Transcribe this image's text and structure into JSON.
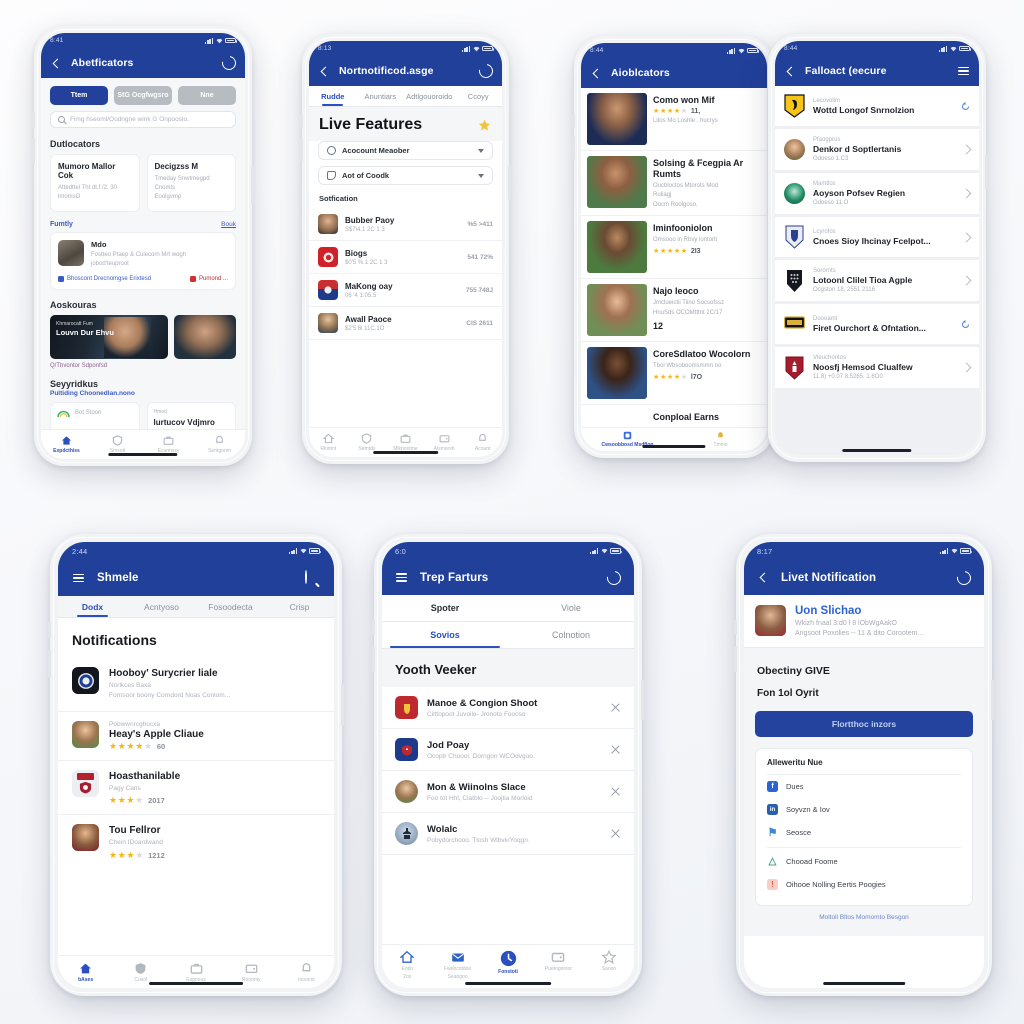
{
  "meta": {
    "accent_blue": "#21409a",
    "tab_blue": "#2b4fbf",
    "star_gold": "#f5b616",
    "bg": "#f7f8fb"
  },
  "phone1": {
    "status": {
      "time": "8:41",
      "signal": "signal-icon",
      "wifi": "wifi-icon",
      "battery": "battery-icon"
    },
    "appbar": {
      "back": "back-icon",
      "title": "Abetficators",
      "action": "refresh-icon"
    },
    "chips": [
      {
        "label": "Ttem",
        "active": true
      },
      {
        "label": "StG Ocgfwgsro",
        "active": false
      },
      {
        "label": "Nne",
        "active": false
      }
    ],
    "search": {
      "placeholder": "Fimg hseoml/Oodngne wink G Onpooslo.",
      "icon": "search-icon"
    },
    "section1": {
      "title": "Dutlocators"
    },
    "cards": [
      {
        "title": "Mumoro Mallor Cok",
        "sub": "Attedttel Tht dt.f /2. 30\nlmomsO"
      },
      {
        "title": "Decigzss M",
        "sub": "Tmeday Snwtmegpd Cnomts\nEoolgvmp"
      }
    ],
    "rowhead": {
      "left": "Fumtly",
      "right": "Bouk"
    },
    "wide": {
      "title": "Mdo",
      "sub": "Fostteo Ptaep & Culecorn Mrt wogh\njobod'teuproot",
      "foot_left": "Bhoscont Drecnomgse Erixtesd",
      "foot_right": "Pumond ..."
    },
    "section2": {
      "title": "Aoskouras"
    },
    "media": {
      "overline": "Khmarocatt Fum",
      "headline": "Louvn Dur Ehvu",
      "caption": "Q/Thvontor Sdponfsd"
    },
    "section3": {
      "title": "Seyyridkus",
      "sub": "Pultiding Choonedlan.nono"
    },
    "bottomcards": [
      {
        "title": "Bot Stoon"
      },
      {
        "title": "Hmod",
        "sub": "lurtucov Vdjmro"
      }
    ],
    "nav": [
      {
        "label": "Expdcthiss",
        "icon": "home-icon",
        "active": true
      },
      {
        "label": "Smsott",
        "icon": "shield-icon",
        "active": false
      },
      {
        "label": "Ecunnssy",
        "icon": "briefcase-icon",
        "active": false
      },
      {
        "label": "Sentgonm",
        "icon": "bell-icon",
        "active": false
      }
    ]
  },
  "phone2": {
    "status": {
      "time": "8:13"
    },
    "appbar": {
      "back": "back-icon",
      "title": "Nortnotificod.asge",
      "action": "refresh-icon"
    },
    "tabs": [
      {
        "label": "Rudde",
        "active": true
      },
      {
        "label": "Anuntiars",
        "active": false
      },
      {
        "label": "Adtlgouoroido",
        "active": false
      },
      {
        "label": "Ccoyy",
        "active": false
      }
    ],
    "hero": {
      "title": "Live Features",
      "badge": "star-badge-icon"
    },
    "dropdowns": [
      {
        "label": "Acocount Meaober",
        "icon": "refresh-circle-icon",
        "caret": "chevron-down-icon"
      },
      {
        "label": "Aot of Coodk",
        "icon": "shield-icon",
        "caret": "chevron-down-icon"
      }
    ],
    "listtitle": "Sotfication",
    "rows": [
      {
        "name": "Bubber Paoy",
        "sub": "S$7i4.1 2C 1 3",
        "value": "%5 >411"
      },
      {
        "name": "Biogs",
        "sub": "$0'5 %.1 2C 1 3",
        "value": "541 72%"
      },
      {
        "name": "MaKong oay",
        "sub": "06 '4 1:05.5",
        "value": "755 748J"
      },
      {
        "name": "Awall Paoce",
        "sub": "$2'5 6l 11C.1O",
        "value": "CIS 2611"
      }
    ],
    "nav": [
      {
        "label": "Rlomnt",
        "icon": "home-icon"
      },
      {
        "label": "Semtds",
        "icon": "shield-icon"
      },
      {
        "label": "Mlknontme",
        "icon": "briefcase-icon"
      },
      {
        "label": "Alsmorsh",
        "icon": "wallet-icon"
      },
      {
        "label": "Acount",
        "icon": "bell-icon"
      }
    ]
  },
  "phone3": {
    "status": {
      "time": "8:44"
    },
    "appbar": {
      "back": "back-icon",
      "title": "Aioblcators"
    },
    "apps": [
      {
        "title": "Como won Mif",
        "desc": "Litos Mo Loshle . hucrys",
        "stars": 4,
        "rating": "11,"
      },
      {
        "title": "Solsing & Fcegpia Ar Rumts",
        "desc": "Oucbloctos Mtorots Mod\nRuliagj\nOocm Roolgoso.",
        "stars": 0,
        "rating": ""
      },
      {
        "title": "Iminfooniolon",
        "desc": "Omsooo in Rbvy lontorti",
        "stars": 5,
        "rating": "2I3"
      },
      {
        "title": "Najo Ieoco",
        "desc": "Jmclueictii Tiino Socsofssz\nHnuSds OCOMtttnt 2C/17",
        "stars": 0,
        "rating": "12"
      },
      {
        "title": "CoreSdlatoo Wocolorn",
        "desc": "Tbol Wbsoboomsmmn no",
        "stars": 4,
        "rating": "l7O"
      },
      {
        "title": "Conploal Earns",
        "desc": "",
        "stars": 0,
        "rating": ""
      }
    ],
    "nav": [
      {
        "label": "Cwsoobbosd Msdflon",
        "icon": "grid-icon",
        "active": true
      },
      {
        "label": "Tmmo",
        "icon": "bell-icon",
        "active": false
      }
    ]
  },
  "phone4": {
    "status": {
      "time": "8:44"
    },
    "appbar": {
      "back": "back-icon",
      "title": "Falloact (eecure",
      "menu": "hamburger-icon"
    },
    "teams": [
      {
        "label": "Lecovolim",
        "name": "Wottd Longof Snrnolzion",
        "sub": "",
        "crest": "crest-yellow-icon",
        "trail": "sync-icon"
      },
      {
        "label": "Pfaogpros",
        "name": "Denkor d Soptlertanis",
        "sub": "Gdoeso 1.C3",
        "crest": "avatar-crest-icon",
        "trail": "chevron-right-icon"
      },
      {
        "label": "Mamtlos",
        "name": "Aoyson Pofsev Regien",
        "sub": "Gdoeso 11.O",
        "crest": "crest-green-icon",
        "trail": "chevron-right-icon"
      },
      {
        "label": "Lcyrofos",
        "name": "Cnoes Sioy Ihcinay Fcelpot...",
        "sub": "",
        "crest": "crest-blue-icon",
        "trail": "chevron-right-icon"
      },
      {
        "label": "Sorornts",
        "name": "Lotoonl Clilel Tioa Agple",
        "sub": "Ocgston 18, 2551 2116",
        "crest": "crest-dark-icon",
        "trail": "chevron-right-icon"
      },
      {
        "label": "Doooamt",
        "name": "Firet Ourchort & Ofntation...",
        "sub": "",
        "crest": "crest-gold-icon",
        "trail": "sync-icon"
      },
      {
        "label": "Vleuchontos",
        "name": "Noosfj Hemsod Clualfew",
        "sub": "11.8) +0.07 8.5265. 1.6O0",
        "crest": "crest-red-icon",
        "trail": "chevron-right-icon"
      }
    ]
  },
  "phone5": {
    "status": {
      "time": "2:44"
    },
    "appbar": {
      "menu": "hamburger-icon",
      "title": "Shmele",
      "action": "search-icon"
    },
    "tabs": [
      {
        "label": "Dodx",
        "active": true
      },
      {
        "label": "Acntyoso",
        "active": false
      },
      {
        "label": "Fosoodecta",
        "active": false
      },
      {
        "label": "Crisp",
        "active": false
      }
    ],
    "header": "Notifications",
    "items": [
      {
        "pre": "",
        "title": "Hooboy' Surycrier liale",
        "desc": "Norlkces  Baxa\nFornsoor boony Corndord Noas Conlom...",
        "stars": 0,
        "rating": ""
      },
      {
        "pre": "Pobwwnrcghocxa",
        "title": "Heay's Apple Cliaue",
        "desc": "",
        "stars": 4,
        "rating": "60"
      },
      {
        "pre": "",
        "title": "Hoasthanilable",
        "desc": "Pagy Cans",
        "stars": 3,
        "rating": "2017"
      },
      {
        "pre": "",
        "title": "Tou Fellror",
        "desc": "Chein IDoardwand",
        "stars": 3,
        "rating": "1212"
      }
    ],
    "nav": [
      {
        "label": "bAses",
        "icon": "home-icon",
        "active": true
      },
      {
        "label": "Cuvol",
        "icon": "shield-icon",
        "active": false
      },
      {
        "label": "Esgoous",
        "icon": "briefcase-icon",
        "active": false
      },
      {
        "label": "Rooonty",
        "icon": "wallet-icon",
        "active": false
      },
      {
        "label": "Ioounnt",
        "icon": "bell-icon",
        "active": false
      }
    ]
  },
  "phone6": {
    "status": {
      "time": "6:0"
    },
    "appbar": {
      "menu": "hamburger-icon",
      "title": "Trep Farturs",
      "action": "refresh-icon"
    },
    "tabs_top": [
      {
        "label": "Spoter",
        "active": false
      },
      {
        "label": "Viole",
        "active": false
      }
    ],
    "tabs_bottom": [
      {
        "label": "Sovios",
        "active": true
      },
      {
        "label": "Colnotion",
        "active": false
      }
    ],
    "header": "Yooth Veeker",
    "items": [
      {
        "title": "Manoe & Congion Shoot",
        "desc": "Cilttopoot Juvoilo- Jronoto Foooso",
        "icon": "crest-red-icon",
        "close": "close-icon"
      },
      {
        "title": "Jod Poay",
        "desc": "Ocoptr Choooi. Dorngon WCOdvgoo.",
        "icon": "crest-blue-icon",
        "close": "close-icon"
      },
      {
        "title": "Mon & Wiinolns Slace",
        "desc": "Foo tot Hhl, Clatblo -- Joojtia Morloid",
        "icon": "avatar-green-icon",
        "close": "close-icon"
      },
      {
        "title": "Wolalc",
        "desc": "Pobydorchooo. Tlosh Wlbvk/Yoqgn.",
        "icon": "statue-icon",
        "close": "close-icon"
      }
    ],
    "nav": [
      {
        "label": "Eotio\n2os",
        "icon": "home-icon",
        "active": false
      },
      {
        "label": "Fwebcotdoo\nSeangoo",
        "icon": "mail-icon",
        "active": false
      },
      {
        "label": "Fonstoti",
        "icon": "clock-icon",
        "active": true
      },
      {
        "label": "Puetogontor",
        "icon": "wallet-icon",
        "active": false
      },
      {
        "label": "Saoso",
        "icon": "star-icon",
        "active": false
      }
    ]
  },
  "phone7": {
    "status": {
      "time": "8:17"
    },
    "appbar": {
      "back": "back-icon",
      "title": "Livet Notification",
      "action": "refresh-icon"
    },
    "profile": {
      "name": "Uon Slichao",
      "line1": "Wkizh  fnaal  3:d0 l 8 lObWgAakO",
      "line2": "Angsoot Poxolies -- 11 & dito Corootem...",
      "avatar": "avatar-icon"
    },
    "h1": "Obectiny GIVE",
    "h2": "Fon 1ol Oyrit",
    "cta": "Flortthoc inzors",
    "box": {
      "header": "Alleweritu Nue",
      "items": [
        {
          "label": "Dues",
          "icon": "facebook-icon",
          "color": "#2b62d4"
        },
        {
          "label": "Soyvzn & Iov",
          "icon": "linkedin-icon",
          "color": "#2a5fb0"
        },
        {
          "label": "Seosce",
          "icon": "twitter-icon",
          "color": "#3b88d8"
        },
        {
          "label": "Chooad Foome",
          "icon": "share-icon",
          "color": "#4aa08e",
          "sep": true
        },
        {
          "label": "Oihooe Nolling Eertis Poogies",
          "icon": "alert-icon",
          "color": "#e4604e"
        }
      ]
    },
    "footer": "Moltoll  Bltos Momomto  Besgon"
  }
}
